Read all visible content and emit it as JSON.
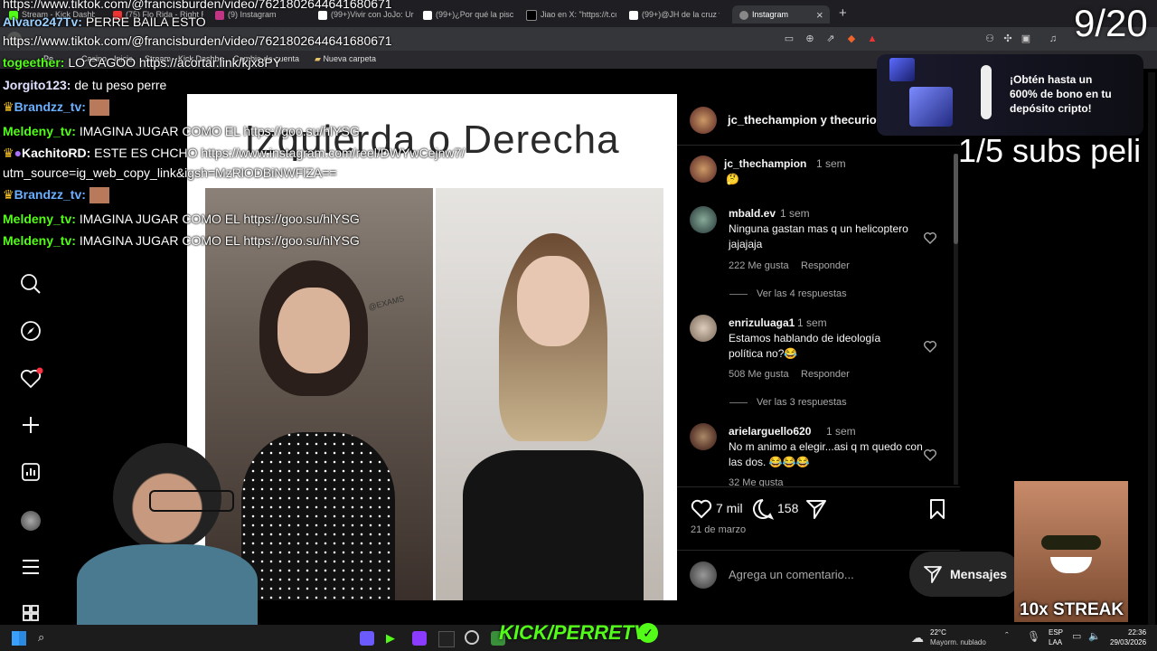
{
  "browser": {
    "tabs": [
      {
        "label": "Stream - Kick Dashbo",
        "active": false
      },
      {
        "label": "(75) Flo Rida - Right R",
        "active": false
      },
      {
        "label": "(9) Instagram",
        "active": false
      },
      {
        "label": "(99+)Vivir con JoJo: Ur",
        "active": false
      },
      {
        "label": "(99+)¿Por qué la piscir",
        "active": false
      },
      {
        "label": "Jiao en X: \"https://t.co/",
        "active": false
      },
      {
        "label": "(99+)@JH de la cruz ve",
        "active": false
      },
      {
        "label": "Instagram",
        "active": true
      }
    ],
    "new_tab": "+",
    "close_tab": "×",
    "url": "https://www.tiktok.com/@francisburden/video/7621802644641680671",
    "bookmarks": [
      "Pe...",
      "Casino - Inicio",
      "Stream - Kick Dashbo...",
      "Cambio de cuenta",
      "Nueva carpeta"
    ]
  },
  "chat": [
    {
      "user": "",
      "text": "https://www.tiktok.com/@francisburden/video/7621802644641680671",
      "color": "#ffffff"
    },
    {
      "user": "Alvaro247Tv:",
      "text": "PERRE BAILA ESTO",
      "color": "#9bd0ff"
    },
    {
      "user": "",
      "text": "https://www.tiktok.com/@francisburden/video/7621802644641680671",
      "color": "#ffffff"
    },
    {
      "user": "togeether:",
      "text": "LO CAGOO https://acortar.link/kjx8PY",
      "color": "#53fc18"
    },
    {
      "user": "Jorgito123:",
      "text": "de tu peso perre",
      "color": "#e0e0ff"
    },
    {
      "user": "Brandzz_tv:",
      "text": "",
      "color": "#6ab0ff"
    },
    {
      "user": "Meldeny_tv:",
      "text": "IMAGINA JUGAR COMO EL https://goo.su/hlYSG",
      "color": "#53fc18"
    },
    {
      "user": "KachitoRD:",
      "text": "ESTE ES CHCHO https://www.instagram.com/reel/DWYwCejnw7/",
      "color": "#ffffff"
    },
    {
      "user": "",
      "text": "utm_source=ig_web_copy_link&igsh=MzRlODBiNWFlZA==",
      "color": "#ffffff"
    },
    {
      "user": "Brandzz_tv:",
      "text": "",
      "color": "#6ab0ff"
    },
    {
      "user": "Meldeny_tv:",
      "text": "IMAGINA JUGAR COMO EL https://goo.su/hlYSG",
      "color": "#53fc18"
    },
    {
      "user": "Meldeny_tv:",
      "text": "IMAGINA JUGAR COMO EL https://goo.su/hlYSG",
      "color": "#53fc18"
    }
  ],
  "overlays": {
    "counter": "9/20",
    "subs": "1/5 subs peli",
    "ad_text": "¡Obtén hasta un 600% de bono en tu depósito cripto!",
    "streak": "10x STREAK",
    "brand": "KICK/PERRETV"
  },
  "post": {
    "title": "Izquierda o Derecha",
    "watermark": "@EXAMS",
    "header_users": "jc_thechampion y thecurious",
    "caption_user": "jc_thechampion",
    "caption_time": "1 sem",
    "caption_emoji": "🤔",
    "comments": [
      {
        "user": "mbald.ev",
        "time": "1 sem",
        "text": "Ninguna gastan mas q un helicoptero jajajaja",
        "likes": "222 Me gusta",
        "reply": "Responder",
        "replies": "Ver las 4 respuestas"
      },
      {
        "user": "enrizuluaga1",
        "time": "1 sem",
        "text": "Estamos hablando de ideología política no?😂",
        "likes": "508 Me gusta",
        "reply": "Responder",
        "replies": "Ver las 3 respuestas"
      },
      {
        "user": "arielarguello620",
        "time": "1 sem",
        "text": "No m animo a elegir...asi q m quedo con las dos. 😂😂😂",
        "likes": "32 Me gusta",
        "reply": "Responder",
        "replies": ""
      }
    ],
    "like_count": "7 mil",
    "comment_count": "158",
    "date": "21 de marzo",
    "comment_placeholder": "Agrega un comentario...",
    "messages_label": "Mensajes"
  },
  "taskbar": {
    "weather_temp": "22°C",
    "weather_desc": "Mayorm. nublado",
    "lang1": "ESP",
    "lang2": "LAA",
    "time": "22:36",
    "date": "29/03/2026"
  },
  "colors": {
    "kick_green": "#53fc18",
    "ig_bg": "#000000",
    "chrome_bg": "#35363a"
  }
}
